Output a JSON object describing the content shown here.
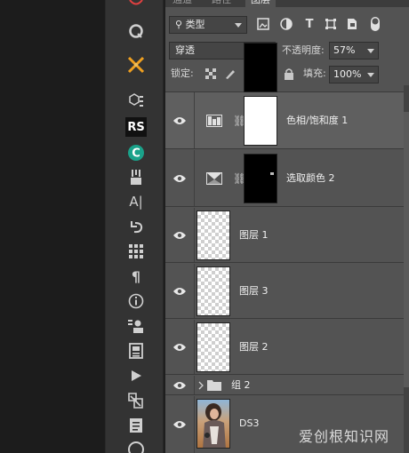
{
  "toolbar": {
    "tools": [
      {
        "name": "lasso-icon"
      },
      {
        "name": "brush-crossed-icon"
      },
      {
        "name": "cube-list-icon"
      },
      {
        "name": "rs-plugin-icon",
        "label": "RS"
      },
      {
        "name": "c-plugin-icon",
        "label": "C"
      },
      {
        "name": "brushes-icon"
      },
      {
        "name": "character-icon",
        "label": "A|"
      },
      {
        "name": "history-icon"
      },
      {
        "name": "grid-icon"
      },
      {
        "name": "paragraph-icon",
        "label": "¶"
      },
      {
        "name": "info-icon",
        "label": "i"
      },
      {
        "name": "clone-source-icon"
      },
      {
        "name": "notes-icon"
      },
      {
        "name": "play-icon"
      },
      {
        "name": "3d-icon"
      },
      {
        "name": "document-icon"
      },
      {
        "name": "cc-libraries-icon"
      }
    ]
  },
  "panel": {
    "tabs": [
      "通道",
      "路径",
      "图层"
    ],
    "filter": {
      "label": "类型"
    },
    "blend_mode": "穿透",
    "opacity_label": "不透明度:",
    "opacity_value": "57%",
    "lock_label": "锁定:",
    "fill_label": "填充:",
    "fill_value": "100%"
  },
  "layers": [
    {
      "name": "色相/饱和度 1",
      "type": "adjustment",
      "adjustment_icon": "hue-saturation-icon",
      "mask": "white"
    },
    {
      "name": "选取颜色 2",
      "type": "adjustment",
      "adjustment_icon": "selective-color-icon",
      "mask": "black"
    },
    {
      "name": "图层 1",
      "type": "pixel"
    },
    {
      "name": "图层 3",
      "type": "pixel"
    },
    {
      "name": "图层 2",
      "type": "pixel"
    },
    {
      "name": "组 2",
      "type": "group"
    },
    {
      "name": "DS3",
      "type": "photo"
    }
  ],
  "watermark": "爱创根知识网",
  "colors": {
    "panel_bg": "#535353",
    "toolbar_bg": "#333333",
    "canvas_bg": "#1c1c1c"
  }
}
